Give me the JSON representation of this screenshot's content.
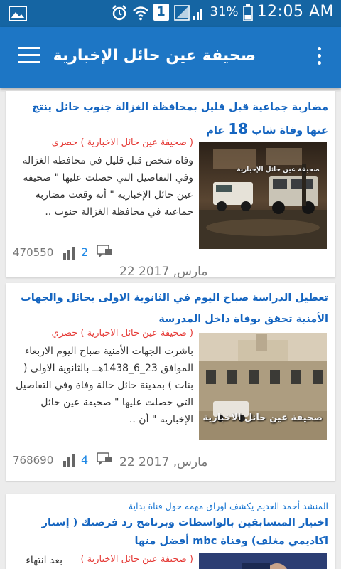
{
  "status_bar": {
    "battery_percent": "31%",
    "time": "12:05 AM",
    "sim_badge": "1",
    "icons": [
      "image-icon",
      "alarm-icon",
      "wifi-icon",
      "signal-icon",
      "battery-icon"
    ]
  },
  "app_bar": {
    "title": "صحيفة عين حائل الإخبارية",
    "menu_icon": "hamburger-icon",
    "more_icon": "more-vert-icon"
  },
  "colors": {
    "status_bar": "#1565a3",
    "app_bar": "#1d76c5",
    "headline": "#1565c0",
    "source": "#e53935",
    "background": "#ececec"
  },
  "articles": [
    {
      "headline_text": "مضاربة جماعية قبل قليل بمحافظة الغزالة جنوب حائل ينتج عنها وفاة شاب",
      "headline_num": "18",
      "headline_tail": "عام",
      "image_watermark": "صحيفة عين حائل الإخبارية",
      "source": "( صحيفة عين حائل الاخبارية ) حصري",
      "excerpt": "وفاة شخص قبل قليل في محافظة الغزالة وفي التفاصيل التي حصلت عليها \" صحيفة عين حائل الإخبارية \" أنه وقعت مضاربه جماعية في محافظة الغزالة جنوب ..",
      "views": "470550",
      "comments": "2",
      "date": "22 مارس, 2017"
    },
    {
      "headline_text": "تعطيل الدراسة صباح اليوم في الثانوية الاولى بحائل والجهات الأمنية تحقق بوفاة داخل المدرسة",
      "image_watermark": "صحيفة عين حائل الاخبارية",
      "source": "( صحيفة عين حائل الاخبارية ) حصري",
      "excerpt": "باشرت الجهات الأمنية صباح اليوم الاربعاء الموافق 23_6_1438هــ بالثانوية الاولى ( بنات ) بمدينة حائل حالة وفاة وفي التفاصيل التي حصلت عليها \" صحيفة عين حائل الإخبارية \" أن ..",
      "views": "768690",
      "comments": "4",
      "date": "22 مارس, 2017"
    },
    {
      "subhead": "المنشد أحمد العديم يكشف اوراق مهمه حول قناة بداية",
      "headline_text": "اختيار المتسابقين بالواسطات وبرنامج زد فرصتك ( إستار اكاديمي مغلف) وقناة mbc أفضل منها",
      "source": "( صحيفة عين حائل الاخبارية )",
      "excerpt": "بعد انتهاء"
    }
  ]
}
